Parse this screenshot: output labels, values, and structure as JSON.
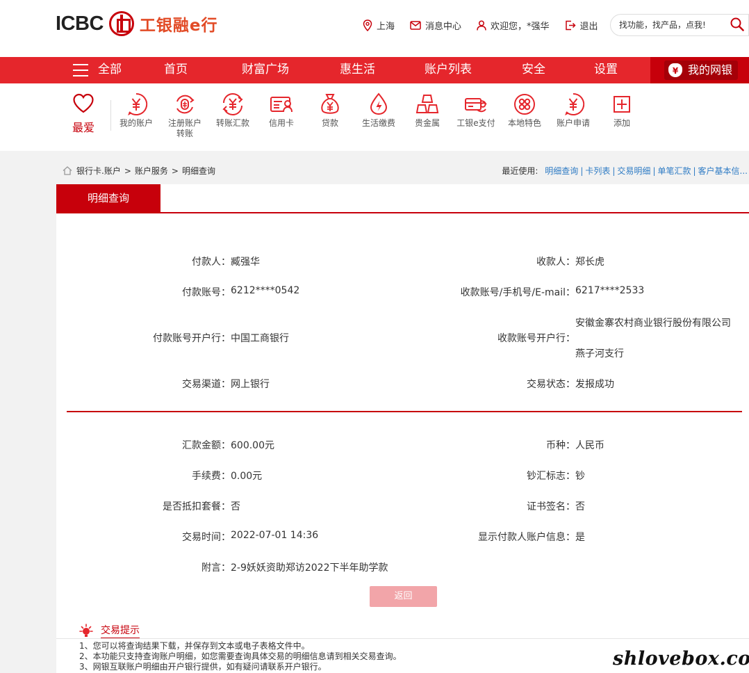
{
  "header": {
    "logo_en": "ICBC",
    "logo_cn": "工银融e行",
    "location": "上海",
    "messages": "消息中心",
    "welcome": "欢迎您，*强华",
    "logout": "退出",
    "search_placeholder": "找功能，找产品，点我!"
  },
  "nav": {
    "all": "全部",
    "items": [
      "首页",
      "财富广场",
      "惠生活",
      "账户列表",
      "安全",
      "设置"
    ],
    "mybank": "我的网银"
  },
  "shortcuts": {
    "favorite": "最爱",
    "items": [
      {
        "label": "我的账户",
        "icon": "yuan-coin-icon"
      },
      {
        "label": "注册账户转账",
        "icon": "register-transfer-icon"
      },
      {
        "label": "转账汇款",
        "icon": "transfer-icon"
      },
      {
        "label": "信用卡",
        "icon": "credit-card-icon"
      },
      {
        "label": "贷款",
        "icon": "money-bag-icon"
      },
      {
        "label": "生活缴费",
        "icon": "utility-drop-icon"
      },
      {
        "label": "贵金属",
        "icon": "gold-bars-icon"
      },
      {
        "label": "工银e支付",
        "icon": "epay-icon"
      },
      {
        "label": "本地特色",
        "icon": "local-icon"
      },
      {
        "label": "账户申请",
        "icon": "apply-icon"
      },
      {
        "label": "添加",
        "icon": "add-icon"
      }
    ]
  },
  "breadcrumb": {
    "items": [
      "银行卡.账户",
      "账户服务",
      "明细查询"
    ],
    "sep": ">"
  },
  "recent": {
    "label": "最近使用:",
    "links": [
      "明细查询",
      "卡列表",
      "交易明细",
      "单笔汇款",
      "客户基本信..."
    ]
  },
  "panel": {
    "tab": "明细查询",
    "payer_label": "付款人：",
    "payer": "臧强华",
    "payee_label": "收款人：",
    "payee": "郑长虎",
    "payer_acct_label": "付款账号：",
    "payer_acct": "6212****0542",
    "payee_acct_label": "收款账号/手机号/E-mail：",
    "payee_acct": "6217****2533",
    "payer_bank_label": "付款账号开户行：",
    "payer_bank": "中国工商银行",
    "payee_bank_label": "收款账号开户行：",
    "payee_bank_line1": "安徽金寨农村商业银行股份有限公司",
    "payee_bank_line2": "燕子河支行",
    "channel_label": "交易渠道：",
    "channel": "网上银行",
    "status_label": "交易状态：",
    "status": "发报成功",
    "amount_label": "汇款金额：",
    "amount": "600.00元",
    "currency_label": "币种：",
    "currency": "人民币",
    "fee_label": "手续费：",
    "fee": "0.00元",
    "cash_label": "钞汇标志：",
    "cash": "钞",
    "package_label": "是否抵扣套餐：",
    "package": "否",
    "cert_label": "证书签名：",
    "cert": "否",
    "time_label": "交易时间：",
    "time": "2022-07-01 14:36",
    "show_payer_label": "显示付款人账户信息：",
    "show_payer": "是",
    "memo_label": "附言：",
    "memo": "2-9妖妖资助郑访2022下半年助学款",
    "back_button": "返回"
  },
  "tips": {
    "title": "交易提示",
    "lines": [
      "1、您可以将查询结果下载，并保存到文本或电子表格文件中。",
      "2、本功能只支持查询账户明细，如您需要查询具体交易的明细信息请到相关交易查询。",
      "3、网银互联账户明细由开户银行提供，如有疑问请联系开户银行。"
    ]
  },
  "watermark": "shlovebox.com",
  "colors": {
    "brand_red": "#c7000b",
    "nav_red": "#e5262c",
    "link_blue": "#2e7bc4"
  }
}
